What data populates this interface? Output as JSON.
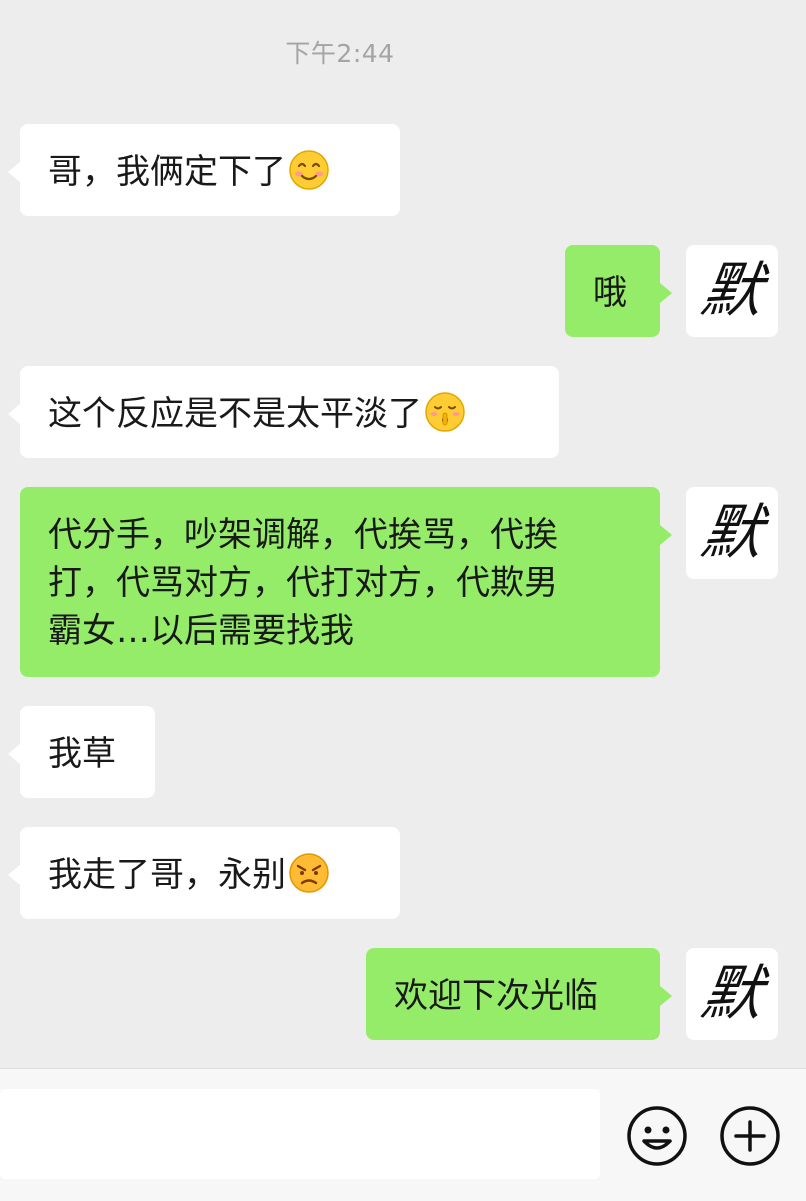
{
  "timestamp": "下午2:44",
  "avatar_char": "默",
  "messages": [
    {
      "side": "left",
      "text": "哥，我俩定下了",
      "emoji": "smiling-face-icon"
    },
    {
      "side": "right",
      "text": "哦"
    },
    {
      "side": "left",
      "text": "这个反应是不是太平淡了",
      "emoji": "shushing-face-icon"
    },
    {
      "side": "right",
      "line1": "代分手，吵架调解，代挨骂，代挨",
      "line2": "打，代骂对方，代打对方，代欺男",
      "line3": "霸女…以后需要找我"
    },
    {
      "side": "left",
      "text": "我草"
    },
    {
      "side": "left",
      "text": "我走了哥，永别",
      "emoji": "angry-face-icon"
    },
    {
      "side": "right",
      "text": "欢迎下次光临"
    }
  ],
  "input_bar": {
    "input_value": "",
    "emoji_button_icon": "smiley-icon",
    "more_button_icon": "plus-circle-icon"
  },
  "colors": {
    "background": "#ededed",
    "bubble_left": "#ffffff",
    "bubble_right": "#95ec69",
    "timestamp_text": "#a4a4a4"
  }
}
